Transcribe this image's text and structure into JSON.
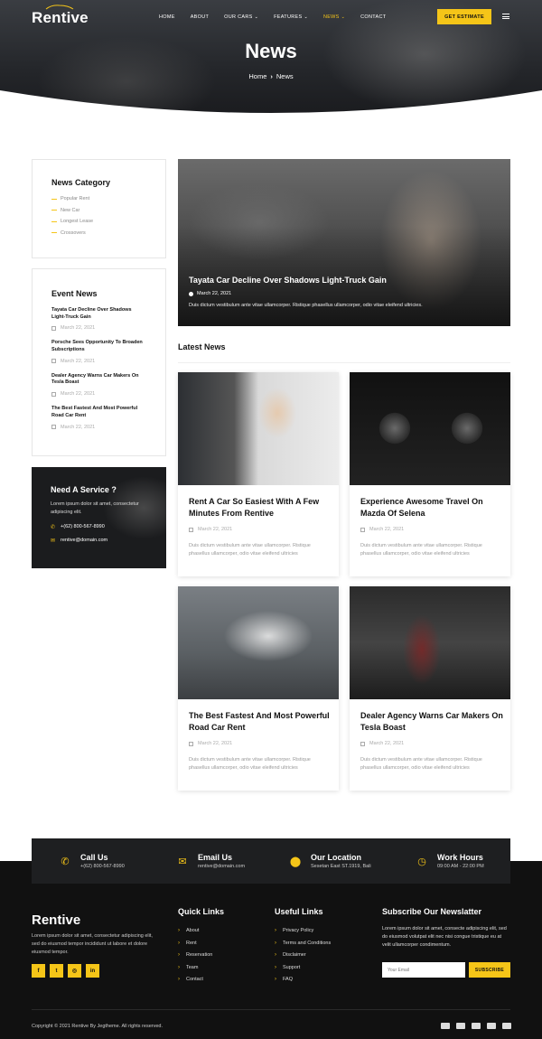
{
  "header": {
    "logo": "Rentive",
    "nav": [
      {
        "label": "HOME",
        "dropdown": false,
        "active": false
      },
      {
        "label": "ABOUT",
        "dropdown": false,
        "active": false
      },
      {
        "label": "OUR CARS",
        "dropdown": true,
        "active": false
      },
      {
        "label": "FEATURES",
        "dropdown": true,
        "active": false
      },
      {
        "label": "NEWS",
        "dropdown": true,
        "active": true
      },
      {
        "label": "CONTACT",
        "dropdown": false,
        "active": false
      }
    ],
    "cta": "GET ESTIMATE",
    "menu_icon": "hamburger-icon"
  },
  "hero": {
    "title": "News",
    "breadcrumb": [
      "Home",
      "News"
    ]
  },
  "sidebar": {
    "categories_title": "News Category",
    "categories": [
      "Popular Rent",
      "New Car",
      "Longest Lease",
      "Crossovers"
    ],
    "events_title": "Event News",
    "events": [
      {
        "title": "Tayata Car Decline Over Shadows Light-Truck Gain",
        "date": "March 22, 2021"
      },
      {
        "title": "Porsche Sees Opportunity To Broaden Subscriptions",
        "date": "March 22, 2021"
      },
      {
        "title": "Dealer Agency Warns Car Makers On Tesla Boast",
        "date": "March 22, 2021"
      },
      {
        "title": "The Best Fastest And Most Powerful Road Car Rent",
        "date": "March 22, 2021"
      }
    ],
    "service": {
      "title": "Need A Service ?",
      "text": "Lorem ipsum dolor sit amet, consectetur adipiscing elit.",
      "phone": "+(62) 800-567-8990",
      "email": "rentive@domain.com"
    }
  },
  "featured": {
    "title": "Tayata Car Decline Over Shadows Light-Truck Gain",
    "date": "March 22, 2021",
    "text": "Duis dictum vestibulum ante vitae ullamcorper. Ristique phasellus ullamcorper, odio vitae eleifend ultricies."
  },
  "latest": {
    "title": "Latest News",
    "cards": [
      {
        "title": "Rent A Car So Easiest With A Few Minutes From Rentive",
        "date": "March 22, 2021",
        "text": "Duis dictum vestibulum ante vitae ullamcorper. Ristique phasellus ullamcorper, odio vitae eleifend ultricies"
      },
      {
        "title": "Experience Awesome Travel On Mazda Of Selena",
        "date": "March 22, 2021",
        "text": "Duis dictum vestibulum ante vitae ullamcorper. Ristique phasellus ullamcorper, odio vitae eleifend ultricies"
      },
      {
        "title": "The Best Fastest And Most Powerful Road Car Rent",
        "date": "March 22, 2021",
        "text": "Duis dictum vestibulum ante vitae ullamcorper. Ristique phasellus ullamcorper, odio vitae eleifend ultricies"
      },
      {
        "title": "Dealer Agency Warns Car Makers On Tesla Boast",
        "date": "March 22, 2021",
        "text": "Duis dictum vestibulum ante vitae ullamcorper. Ristique phasellus ullamcorper, odio vitae eleifend ultricies"
      }
    ]
  },
  "contact_bar": [
    {
      "title": "Call Us",
      "sub": "+(62) 800-567-8990",
      "icon": "phone-icon"
    },
    {
      "title": "Email Us",
      "sub": "rentive@domain.com",
      "icon": "envelope-icon"
    },
    {
      "title": "Our Location",
      "sub": "Sesetan East ST.1919, Bali",
      "icon": "map-pin-icon"
    },
    {
      "title": "Work Hours",
      "sub": "09:00 AM - 22:00 PM",
      "icon": "clock-icon"
    }
  ],
  "footer": {
    "logo": "Rentive",
    "about": "Lorem ipsum dolor sit amet, consectetur adipiscing elit, sed do eiusmod tempor incididunt ut labore et dolore eiusmod tempor.",
    "socials": [
      "f",
      "t",
      "in-ig",
      "in"
    ],
    "quick_links_title": "Quick Links",
    "quick_links": [
      "About",
      "Rent",
      "Reservation",
      "Team",
      "Contact"
    ],
    "useful_links_title": "Useful Links",
    "useful_links": [
      "Privacy Policy",
      "Terms and Conditions",
      "Disclaimer",
      "Support",
      "FAQ"
    ],
    "newsletter_title": "Subscribe Our Newslatter",
    "newsletter_text": "Lorem ipsum dolor sit amet, consecte adipiscing elit, sed do eiusmod volutpat elit nec nisi congue tristique eu at velit ullamcorper condimentum.",
    "email_placeholder": "Your Email",
    "subscribe": "SUBSCRIBE",
    "copyright": "Copyright © 2021 Rentive By Jegtheme. All rights reserved.",
    "payments": [
      "paypal-icon",
      "mastercard-icon",
      "visa-icon",
      "card-icon",
      "visa-icon"
    ]
  },
  "colors": {
    "accent": "#f5c518",
    "dark": "#111111",
    "contact_bar": "#1e1f21"
  }
}
